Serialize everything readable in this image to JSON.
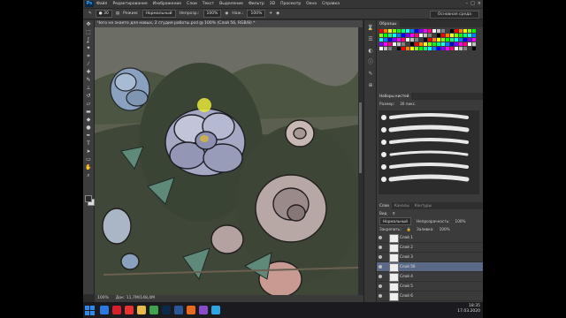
{
  "menubar": {
    "logo": "Ps",
    "items": [
      "Файл",
      "Редактирование",
      "Изображение",
      "Слои",
      "Текст",
      "Выделение",
      "Фильтр",
      "3D",
      "Просмотр",
      "Окно",
      "Справка"
    ]
  },
  "options": {
    "mode_label": "Режим:",
    "mode_value": "Нормальный",
    "opacity_label": "Непрозр.:",
    "opacity_value": "100%",
    "flow_label": "Наж.:",
    "flow_value": "100%",
    "workspace": "Основная среда"
  },
  "document": {
    "tab_title": "Чего не знаете для новых, 2 студия работы.psd @ 100% (Слой 56, RGB/8) *",
    "zoom": "100%",
    "doc_size": "Док: 11,7М/148,4М"
  },
  "panels": {
    "swatch_tabs": [
      "Образцы"
    ],
    "brush_tabs": [
      "Наборы кистей"
    ],
    "brush_size_label": "Размер:",
    "brush_size_value": "30 пикс.",
    "layer_tabs": [
      "Слои",
      "Каналы",
      "Контуры"
    ],
    "layer_kind": "Вид",
    "blend_mode": "Нормальный",
    "opacity_label": "Непрозрачность:",
    "opacity_value": "100%",
    "lock_label": "Закрепить:",
    "fill_label": "Заливка:",
    "fill_value": "100%",
    "layers": [
      "Слой 1",
      "Слой 2",
      "Слой 3",
      "Слой 56",
      "Слой 4",
      "Слой 5",
      "Слой 6",
      "Слой 7"
    ],
    "selected_layer": 3
  },
  "taskbar": {
    "time": "18:35",
    "date": "17.03.2020",
    "apps": [
      "browser",
      "opera",
      "yandex",
      "folder",
      "chrome",
      "photoshop",
      "word",
      "media",
      "paint",
      "telegram"
    ]
  },
  "colors": {
    "accent": "#31a8ff",
    "swatch_palette": [
      "#ff0000",
      "#ff8000",
      "#ffff00",
      "#80ff00",
      "#00ff00",
      "#00ff80",
      "#00ffff",
      "#0080ff",
      "#0000ff",
      "#8000ff",
      "#ff00ff",
      "#ff0080",
      "#ffffff",
      "#c0c0c0",
      "#808080",
      "#404040",
      "#000000"
    ]
  }
}
